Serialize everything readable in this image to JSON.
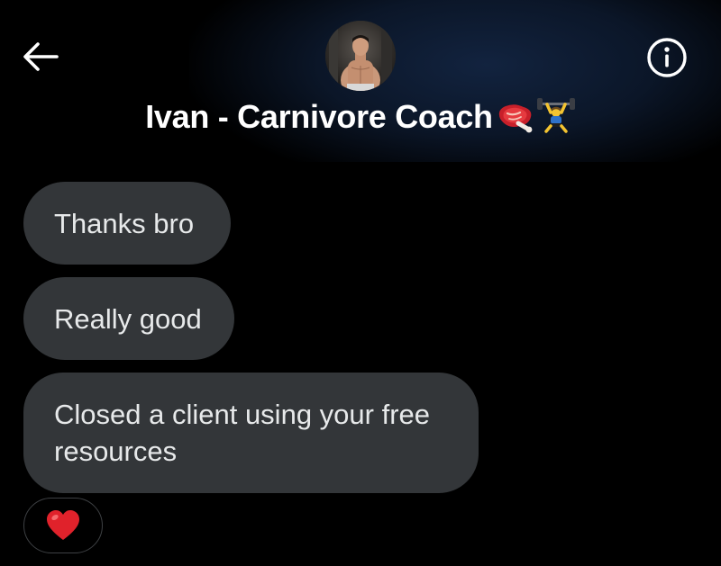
{
  "header": {
    "back_icon": "arrow-left-icon",
    "info_icon": "info-circle-icon",
    "avatar": "profile-photo",
    "contact_name": "Ivan - Carnivore Coach",
    "name_emojis": [
      "steak-emoji",
      "weightlifter-emoji"
    ]
  },
  "messages": [
    {
      "text": "Thanks bro"
    },
    {
      "text": "Really good"
    },
    {
      "text": "Closed a client using your free resources"
    }
  ],
  "reaction": {
    "icon": "red-heart-emoji"
  },
  "colors": {
    "background": "#000000",
    "bubble": "#333639",
    "text": "#e7e9ea",
    "header_glow": "#12233f",
    "heart": "#e0222b"
  }
}
